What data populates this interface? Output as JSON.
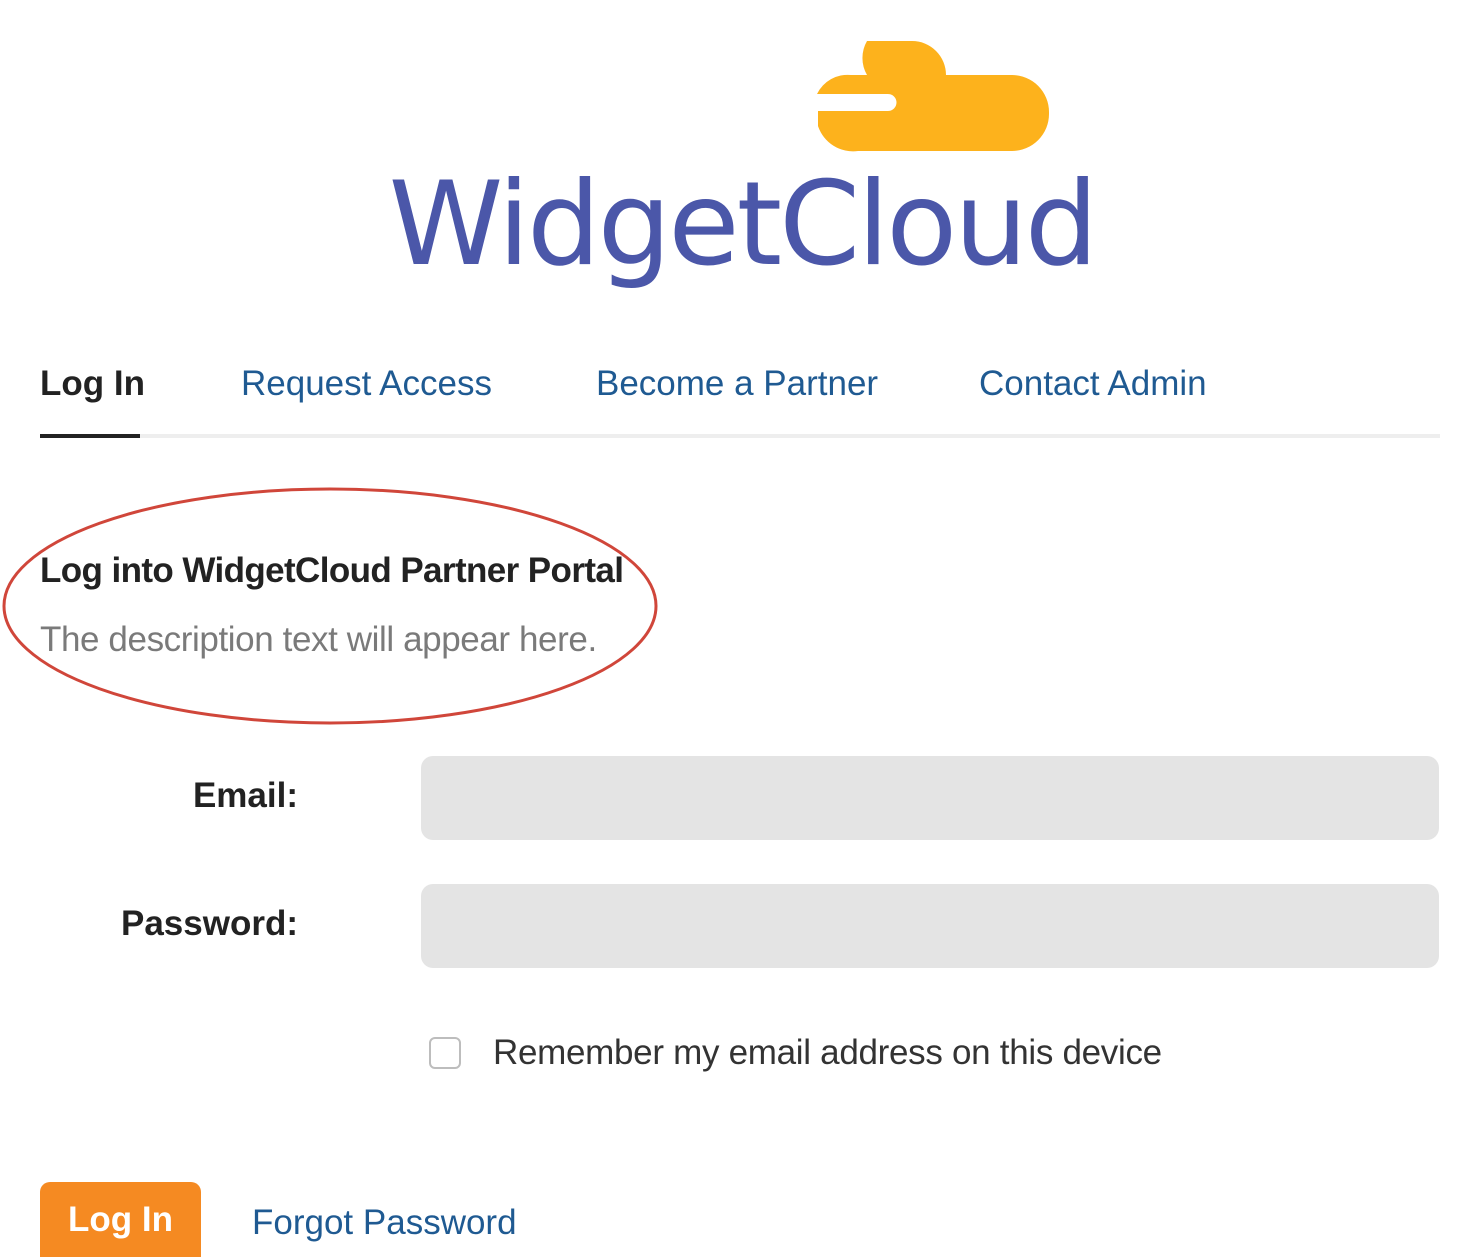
{
  "brand": {
    "name": "WidgetCloud",
    "logo_icon": "cloud-icon",
    "logo_color": "#fdb21c",
    "text_color": "#4b57a9"
  },
  "tabs": [
    {
      "label": "Log In",
      "active": true
    },
    {
      "label": "Request Access",
      "active": false
    },
    {
      "label": "Become a Partner",
      "active": false
    },
    {
      "label": "Contact Admin",
      "active": false
    }
  ],
  "intro": {
    "heading": "Log into WidgetCloud Partner Portal",
    "description": "The description text will appear here.",
    "annotation_color": "#d0463a"
  },
  "form": {
    "email_label": "Email:",
    "email_value": "",
    "password_label": "Password:",
    "password_value": "",
    "remember_label": "Remember my email address on this device",
    "remember_checked": false
  },
  "actions": {
    "login_label": "Log In",
    "forgot_label": "Forgot Password",
    "login_color": "#f58a22",
    "link_color": "#1f5a92"
  }
}
